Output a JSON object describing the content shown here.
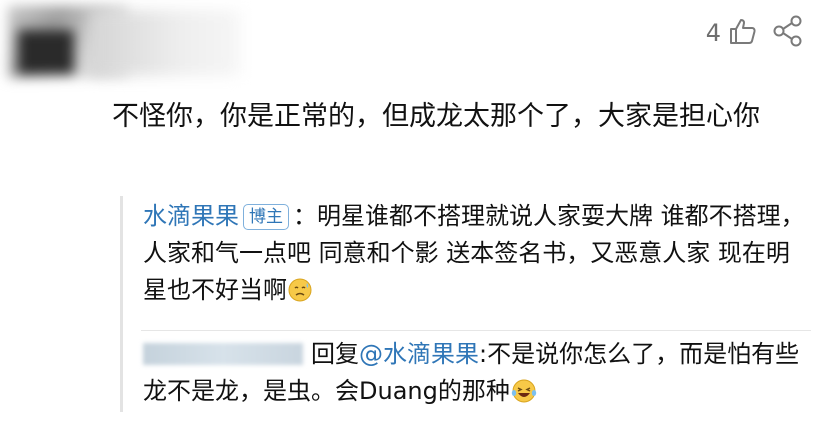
{
  "header": {
    "like_count": "4",
    "icons": {
      "like": "thumbs-up-icon",
      "share": "share-icon"
    }
  },
  "comment": {
    "text": "不怪你，你是正常的，但成龙太那个了，大家是担心你"
  },
  "replies": [
    {
      "author": "水滴果果",
      "badge": "博主",
      "separator": "：",
      "text": "明星谁都不搭理就说人家耍大牌 谁都不搭理，人家和气一点吧 同意和个影 送本签名书，又恶意人家 现在明星也不好当啊",
      "emoji": "sweat-face-icon"
    },
    {
      "prefix": "回复",
      "mention": "@水滴果果",
      "text": ":不是说你怎么了，而是怕有些龙不是龙，是虫。会Duang的那种",
      "emoji": "laughing-face-icon"
    }
  ],
  "colors": {
    "link": "#2f76b7",
    "text": "#111111",
    "muted": "#6e6e6e"
  }
}
